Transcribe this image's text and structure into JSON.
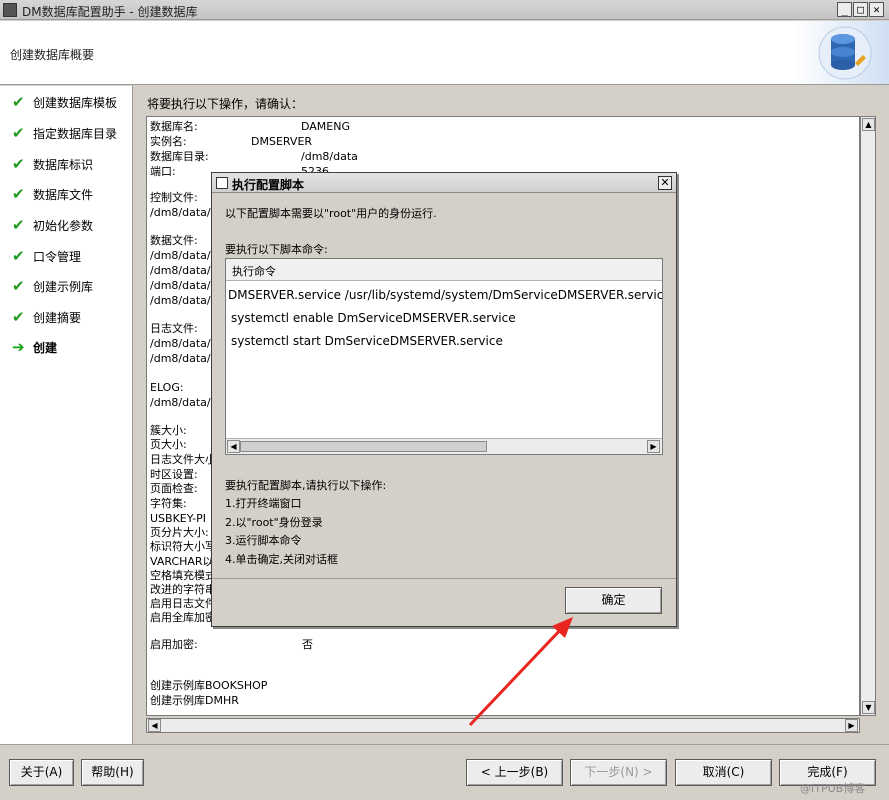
{
  "window": {
    "title": "DM数据库配置助手 - 创建数据库",
    "min": "_",
    "max": "□",
    "close": "✕"
  },
  "header": {
    "title": "创建数据库概要"
  },
  "steps": [
    {
      "label": "创建数据库模板",
      "state": "done"
    },
    {
      "label": "指定数据库目录",
      "state": "done"
    },
    {
      "label": "数据库标识",
      "state": "done"
    },
    {
      "label": "数据库文件",
      "state": "done"
    },
    {
      "label": "初始化参数",
      "state": "done"
    },
    {
      "label": "口令管理",
      "state": "done"
    },
    {
      "label": "创建示例库",
      "state": "done"
    },
    {
      "label": "创建摘要",
      "state": "done"
    },
    {
      "label": "创建",
      "state": "current"
    }
  ],
  "main": {
    "confirm_label": "将要执行以下操作，请确认：",
    "summary_rows": [
      {
        "label": "数据库名:",
        "value": "DAMENG"
      },
      {
        "label": "实例名:",
        "value": "DMSERVER"
      },
      {
        "label": "数据库目录:",
        "value": "/dm8/data"
      },
      {
        "label": "端口:",
        "value": "5236"
      },
      {
        "label": "控制文件:",
        "value": ""
      },
      {
        "label": "/dm8/data/",
        "value": ""
      },
      {
        "label": "数据文件:",
        "value": ""
      },
      {
        "label": "/dm8/data/",
        "value": ""
      },
      {
        "label": "/dm8/data/",
        "value": ""
      },
      {
        "label": "/dm8/data/",
        "value": ""
      },
      {
        "label": "/dm8/data/",
        "value": ""
      },
      {
        "label": "日志文件:",
        "value": ""
      },
      {
        "label": "/dm8/data/",
        "value": ""
      },
      {
        "label": "/dm8/data/",
        "value": ""
      },
      {
        "label": "ELOG:",
        "value": ""
      },
      {
        "label": "/dm8/data/",
        "value": ""
      },
      {
        "label": "簇大小:",
        "value": ""
      },
      {
        "label": "页大小:",
        "value": ""
      },
      {
        "label": "日志文件大小",
        "value": ""
      },
      {
        "label": "时区设置:",
        "value": ""
      },
      {
        "label": "页面检查:",
        "value": ""
      },
      {
        "label": "字符集:",
        "value": ""
      },
      {
        "label": "USBKEY-PI",
        "value": ""
      },
      {
        "label": "页分片大小:",
        "value": ""
      },
      {
        "label": "标识符大小写",
        "value": ""
      },
      {
        "label": "VARCHAR以",
        "value": ""
      },
      {
        "label": "空格填充模式",
        "value": ""
      },
      {
        "label": "改进的字符串",
        "value": ""
      },
      {
        "label": "启用日志文件",
        "value": ""
      },
      {
        "label": "启用全库加密",
        "value": ""
      },
      {
        "label": "启用加密:",
        "value": "否"
      },
      {
        "label": "创建示例库BOOKSHOP",
        "value": ""
      },
      {
        "label": "创建示例库DMHR",
        "value": ""
      }
    ]
  },
  "buttons": {
    "about": "关于(A)",
    "help": "帮助(H)",
    "prev": "< 上一步(B)",
    "next": "下一步(N) >",
    "cancel": "取消(C)",
    "finish": "完成(F)"
  },
  "dialog": {
    "title": "执行配置脚本",
    "close": "✕",
    "intro": "以下配置脚本需要以\"root\"用户的身份运行.",
    "commands_label": "要执行以下脚本命令:",
    "column_header": "执行命令",
    "commands": [
      "DMSERVER.service /usr/lib/systemd/system/DmServiceDMSERVER.service",
      "systemctl enable DmServiceDMSERVER.service",
      "systemctl start DmServiceDMSERVER.service"
    ],
    "instructions_title": "要执行配置脚本,请执行以下操作:",
    "instructions": [
      "1.打开终端窗口",
      "2.以\"root\"身份登录",
      "3.运行脚本命令",
      "4.单击确定,关闭对话框"
    ],
    "ok": "确定"
  },
  "watermark": "@ITPUB博客",
  "colors": {
    "check": "#1e9a1e",
    "annotation_arrow": "#e8261f"
  }
}
